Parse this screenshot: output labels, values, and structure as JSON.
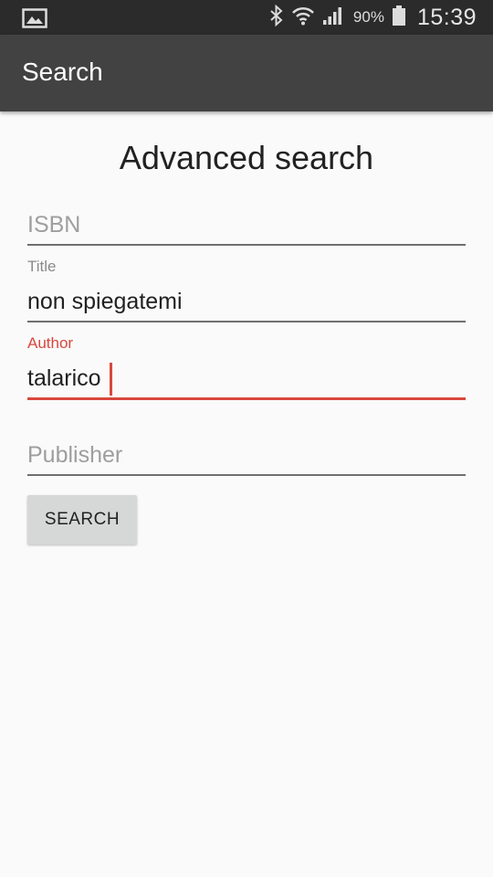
{
  "status_bar": {
    "left_icon": "gallery-icon",
    "icons": [
      "bluetooth-icon",
      "wifi-icon",
      "signal-icon",
      "battery-icon"
    ],
    "battery": "90%",
    "time": "15:39"
  },
  "app_bar": {
    "title": "Search"
  },
  "form": {
    "heading": "Advanced search",
    "isbn": {
      "placeholder": "ISBN",
      "value": ""
    },
    "title": {
      "label": "Title",
      "value": "non spiegatemi"
    },
    "author": {
      "label": "Author",
      "value": "talarico"
    },
    "publisher": {
      "placeholder": "Publisher",
      "value": ""
    },
    "search_button": "SEARCH"
  },
  "colors": {
    "accent": "#d9473d",
    "app_bar": "#424242",
    "status_bar": "#2b2b2b",
    "background": "#fafafa"
  }
}
